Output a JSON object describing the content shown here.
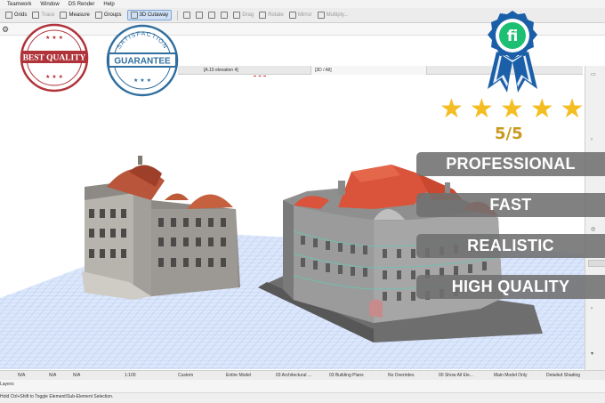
{
  "menu": [
    "Teamwork",
    "Window",
    "DS Render",
    "Help"
  ],
  "toolbar": {
    "grids": "Grids",
    "trace": "Trace",
    "measure": "Measure",
    "groups": "Groups",
    "cutaway": "3D Cutaway",
    "drag": "Drag",
    "rotate": "Rotate",
    "mirror": "Mirror",
    "multiply": "Multiply..."
  },
  "tabs": {
    "tab1": "[A.15 elevation 4]",
    "tab2": "[3D / All]"
  },
  "statusbar": {
    "na1": "N/A",
    "na2": "N/A",
    "na3": "N/A",
    "scale": "1:100",
    "custom": "Custom",
    "model": "Entire Model",
    "arch": "03 Architectural ...",
    "plans": "03 Building Plans",
    "overrides": "No Overrides",
    "show_all": "00 Show All Ele...",
    "main_model": "Main Model Only",
    "shading": "Detailed Shading"
  },
  "layers_label": "Layers:",
  "hint": "Hold Ctrl+Shift to Toggle Element/Sub-Element Selection.",
  "badges": {
    "best_quality": "BEST QUALITY",
    "guarantee": "GUARANTEE",
    "satisfaction": "SATISFACTION",
    "logo": "fi"
  },
  "rating": {
    "stars": 5,
    "text": "5/5"
  },
  "features": [
    "PROFESSIONAL",
    "FAST",
    "REALISTIC",
    "HIGH QUALITY"
  ],
  "colors": {
    "badge_red": "#b0333a",
    "badge_blue": "#2f6e9f",
    "ribbon_blue": "#1a5fa8",
    "logo_green": "#1dbf73",
    "star_gold": "#f4bd21",
    "pill_gray": "#707070",
    "roof_orange": "#d9543a",
    "floor_grid": "#b9cdf0"
  }
}
